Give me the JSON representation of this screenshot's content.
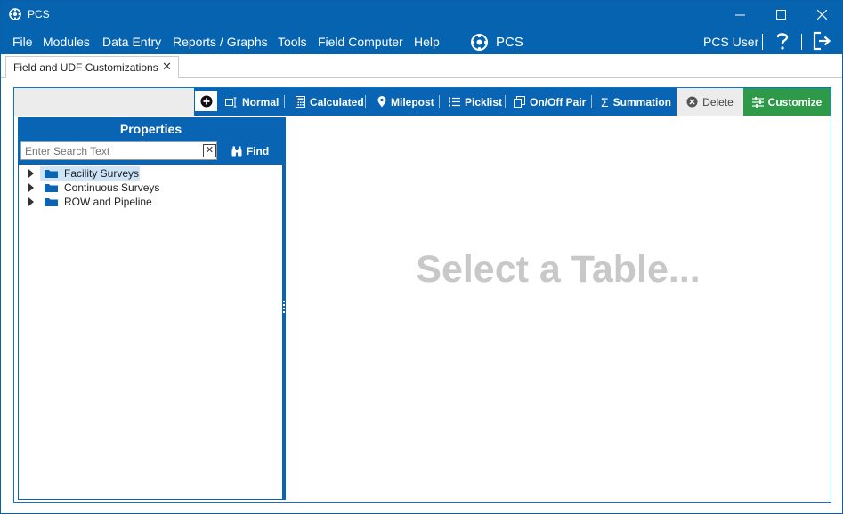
{
  "window": {
    "title": "PCS"
  },
  "menu": {
    "items": [
      "File",
      "Modules",
      "Data Entry",
      "Reports / Graphs",
      "Tools",
      "Field Computer",
      "Help"
    ],
    "brand": "PCS",
    "user": "PCS User"
  },
  "tabs": [
    {
      "label": "Field and UDF Customizations",
      "close": "✕"
    }
  ],
  "toolbar": {
    "add_icon": "plus-circle-icon",
    "items": [
      {
        "label": "Normal",
        "icon": "normal-field-icon"
      },
      {
        "label": "Calculated",
        "icon": "calculator-icon"
      },
      {
        "label": "Milepost",
        "icon": "map-pin-icon"
      },
      {
        "label": "Picklist",
        "icon": "list-icon"
      },
      {
        "label": "On/Off Pair",
        "icon": "copy-icon"
      },
      {
        "label": "Summation",
        "icon": "sigma-icon"
      }
    ],
    "delete_label": "Delete",
    "customize_label": "Customize"
  },
  "properties": {
    "title": "Properties",
    "search_placeholder": "Enter Search Text",
    "search_value": "",
    "clear": "✕",
    "find_label": "Find",
    "tree": [
      {
        "label": "Facility Surveys",
        "selected": true
      },
      {
        "label": "Continuous Surveys",
        "selected": false
      },
      {
        "label": "ROW and Pipeline",
        "selected": false
      }
    ]
  },
  "main": {
    "placeholder": "Select a Table..."
  },
  "colors": {
    "primary": "#0563b0",
    "accent_green": "#2e9a49",
    "selection": "#cde3f8",
    "placeholder": "#c8c8c8"
  }
}
